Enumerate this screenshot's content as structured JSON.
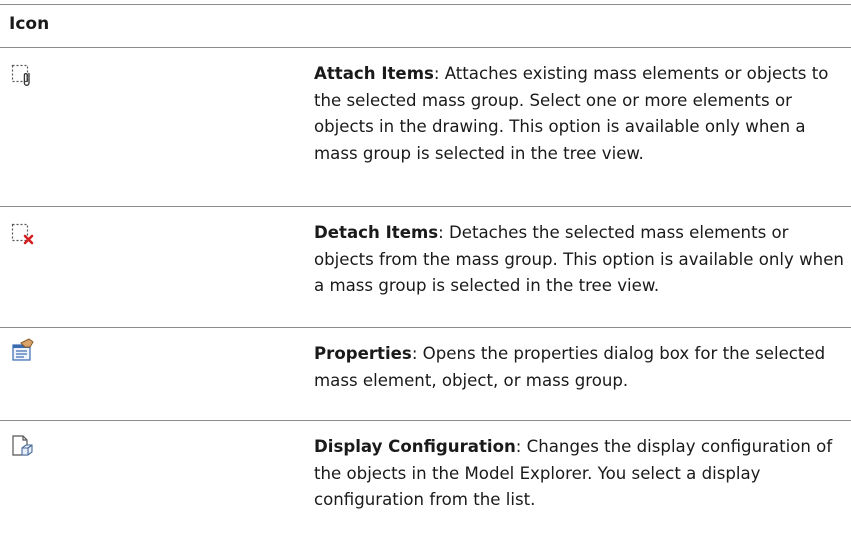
{
  "table": {
    "header": "Icon",
    "rows": [
      {
        "icon": "attach-items-icon",
        "name": "Attach Items",
        "text": ": Attaches existing mass elements or objects to the selected mass group. Select one or more elements or objects in the drawing. This option is available only when a mass group is selected in the tree view."
      },
      {
        "icon": "detach-items-icon",
        "name": "Detach Items",
        "text": ": Detaches the selected mass elements or objects from the mass group. This option is available only when a mass group is selected in the tree view."
      },
      {
        "icon": "properties-icon",
        "name": "Properties",
        "text": ": Opens the properties dialog box for the selected mass element, object, or mass group."
      },
      {
        "icon": "display-configuration-icon",
        "name": "Display Configuration",
        "text": ": Changes the display configuration of the objects in the Model Explorer. You select a display configuration from the list."
      }
    ]
  }
}
